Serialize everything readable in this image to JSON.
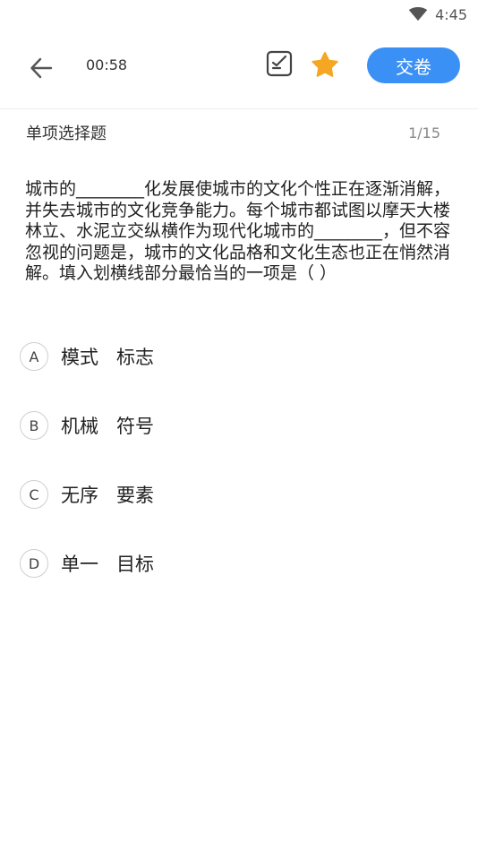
{
  "status_bar": {
    "time": "4:45",
    "wifi_icon": "wifi-icon"
  },
  "header": {
    "back_icon": "arrow-left-icon",
    "timer": "00:58",
    "answer_sheet_icon": "answer-sheet-icon",
    "favorite_icon": "star-icon",
    "favorite_color": "#f5a623",
    "submit_label": "交卷",
    "accent_color": "#3a90f4"
  },
  "question": {
    "type": "单项选择题",
    "progress": "1/15",
    "text": "城市的________化发展使城市的文化个性正在逐渐消解，并失去城市的文化竞争能力。每个城市都试图以摩天大楼林立、水泥立交纵横作为现代化城市的________，但不容忽视的问题是，城市的文化品格和文化生态也正在悄然消解。填入划横线部分最恰当的一项是（    ）"
  },
  "options": [
    {
      "letter": "A",
      "text": "模式   标志"
    },
    {
      "letter": "B",
      "text": "机械   符号"
    },
    {
      "letter": "C",
      "text": "无序   要素"
    },
    {
      "letter": "D",
      "text": "单一   目标"
    }
  ]
}
